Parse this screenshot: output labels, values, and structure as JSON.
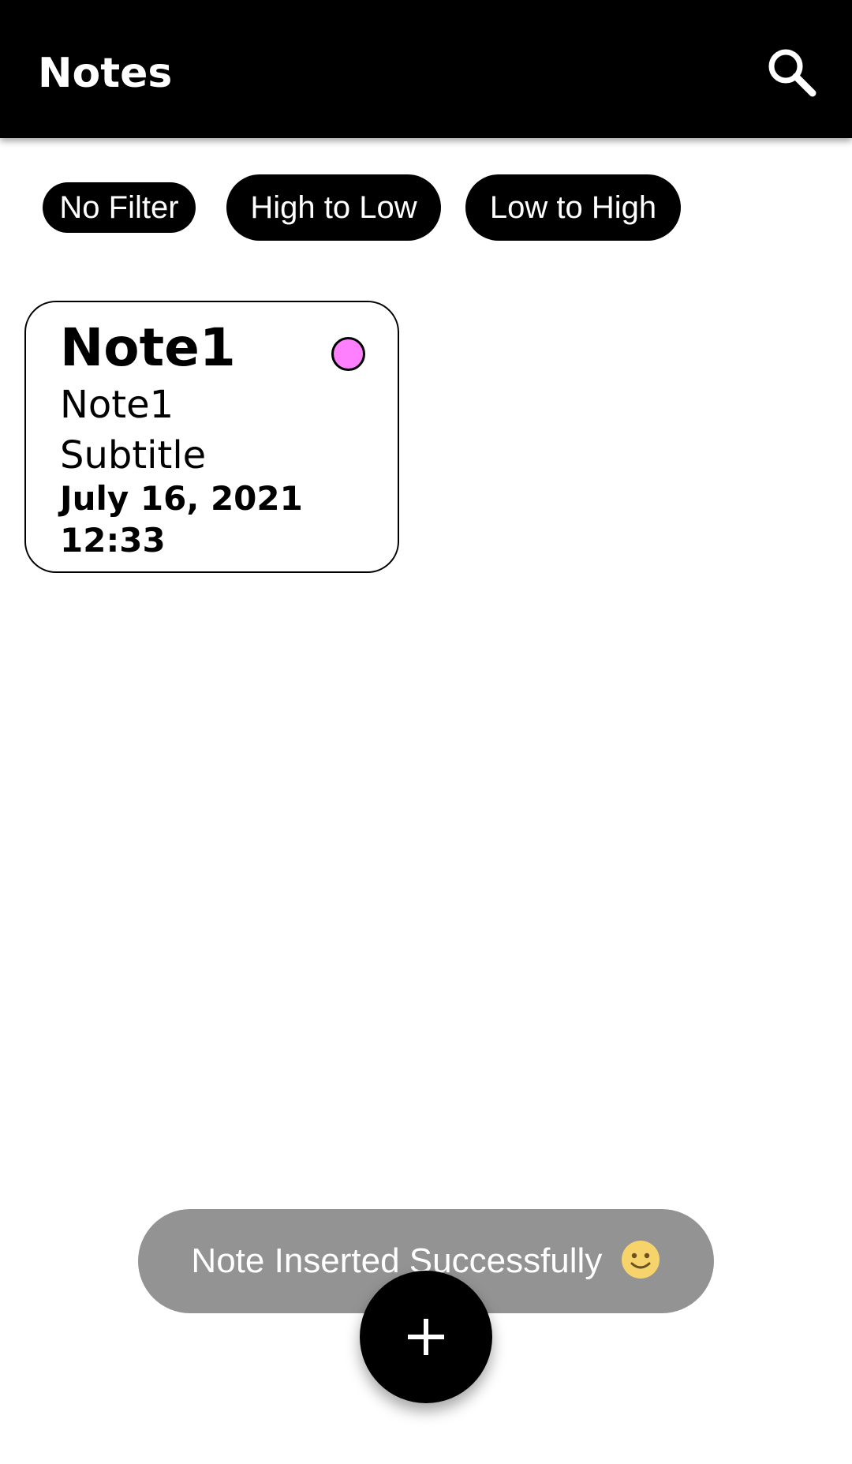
{
  "app_bar": {
    "title": "Notes",
    "search_icon": "search-icon"
  },
  "filters": [
    {
      "label": "No Filter"
    },
    {
      "label": "High to Low"
    },
    {
      "label": "Low to High"
    }
  ],
  "notes": [
    {
      "title": "Note1",
      "subtitle": "Note1 Subtitle",
      "datetime": "July 16, 2021 12:33",
      "priority_color": "#ff80ff"
    }
  ],
  "toast": {
    "message": "Note Inserted Successfully",
    "emoji_icon": "smiley-face-icon"
  },
  "fab": {
    "icon": "plus-icon"
  },
  "colors": {
    "app_bar": "#000000",
    "chip": "#000000",
    "toast": "#939393"
  }
}
